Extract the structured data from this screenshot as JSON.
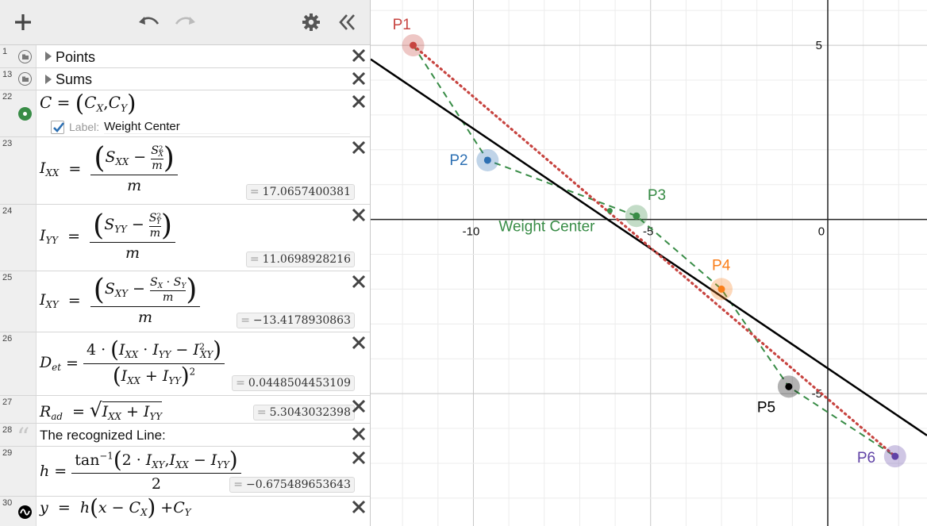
{
  "toolbar": {
    "add": "add-expression",
    "undo": "undo",
    "redo": "redo",
    "settings": "graph-settings",
    "collapse": "collapse-list"
  },
  "rows": {
    "r1": {
      "num": "1",
      "label": "Points"
    },
    "r13": {
      "num": "13",
      "label": "Sums"
    },
    "r22": {
      "num": "22",
      "checkbox_label": "Label:",
      "label_value": "Weight Center",
      "checked": true
    },
    "r23": {
      "num": "23",
      "value": "17.0657400381"
    },
    "r24": {
      "num": "24",
      "value": "11.0698928216"
    },
    "r25": {
      "num": "25",
      "value": "−13.4178930863"
    },
    "r26": {
      "num": "26",
      "value": "0.0448504453109"
    },
    "r27": {
      "num": "27",
      "value": "5.3043032398"
    },
    "r28": {
      "num": "28",
      "note": "The recognized Line:"
    },
    "r29": {
      "num": "29",
      "value": "−0.675489653643"
    },
    "r30": {
      "num": "30"
    }
  },
  "colors": {
    "red": "#c74440",
    "blue": "#2d70b3",
    "green": "#388c46",
    "orange": "#fa7e19",
    "purple": "#6042a6",
    "black": "#000000",
    "toolbar_bg": "#ededed"
  },
  "graph": {
    "x_ticks": [
      "-10",
      "-5",
      "0"
    ],
    "y_ticks": [
      "5",
      "-5"
    ],
    "xlim": [
      -12.9,
      2.8
    ],
    "ylim": [
      -8.8,
      6.3
    ],
    "grid": true,
    "points": [
      {
        "label": "P1",
        "x": -11.7,
        "y": 5.0,
        "color": "red"
      },
      {
        "label": "P2",
        "x": -9.6,
        "y": 1.7,
        "color": "blue"
      },
      {
        "label": "P3",
        "x": -5.4,
        "y": 0.1,
        "color": "green"
      },
      {
        "label": "P4",
        "x": -3.0,
        "y": -2.0,
        "color": "orange"
      },
      {
        "label": "P5",
        "x": -1.1,
        "y": -4.8,
        "color": "black"
      },
      {
        "label": "P6",
        "x": 1.9,
        "y": -6.8,
        "color": "purple"
      }
    ],
    "weight_center": {
      "label": "Weight Center",
      "x": -6.15,
      "y": 0.25,
      "color": "green"
    },
    "fit_line": {
      "p1": [
        -12.9,
        4.6
      ],
      "p2": [
        2.8,
        -6.2
      ],
      "color": "black"
    },
    "dotted_line": {
      "from": "P1",
      "to": "P6",
      "color": "red"
    }
  }
}
